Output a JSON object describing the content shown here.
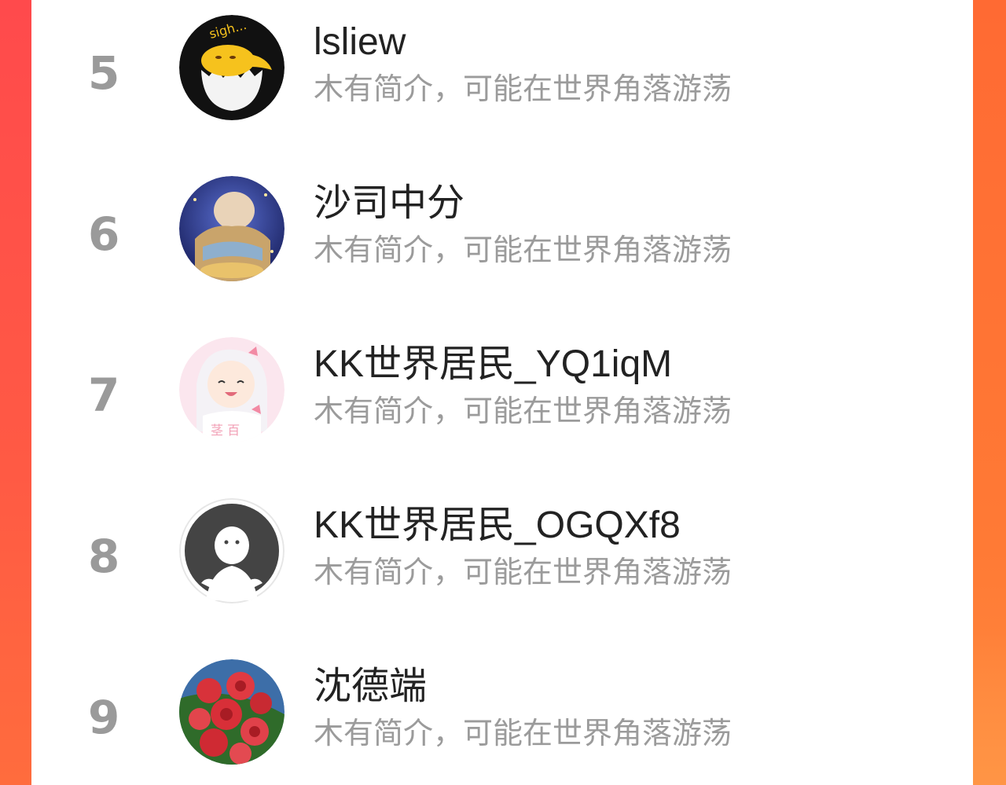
{
  "colors": {
    "panel_bg": "#ffffff",
    "rank_text": "#9a9a9a",
    "name_text": "#222222",
    "bio_text": "#9b9b9b",
    "side_left": "#ff4d4f",
    "side_right": "#ff7a35"
  },
  "users": [
    {
      "rank": "5",
      "name": "lsliew",
      "bio": "木有简介，可能在世界角落游荡",
      "avatar_icon": "gudetama-egg-avatar-icon"
    },
    {
      "rank": "6",
      "name": "沙司中分",
      "bio": "木有简介，可能在世界角落游荡",
      "avatar_icon": "anime-girl-night-avatar-icon"
    },
    {
      "rank": "7",
      "name": "KK世界居民_YQ1iqM",
      "bio": "木有简介，可能在世界角落游荡",
      "avatar_icon": "anime-girl-pink-avatar-icon"
    },
    {
      "rank": "8",
      "name": "KK世界居民_OGQXf8",
      "bio": "木有简介，可能在世界角落游荡",
      "avatar_icon": "default-user-avatar-icon"
    },
    {
      "rank": "9",
      "name": "沈德端",
      "bio": "木有简介，可能在世界角落游荡",
      "avatar_icon": "roses-avatar-icon"
    }
  ]
}
